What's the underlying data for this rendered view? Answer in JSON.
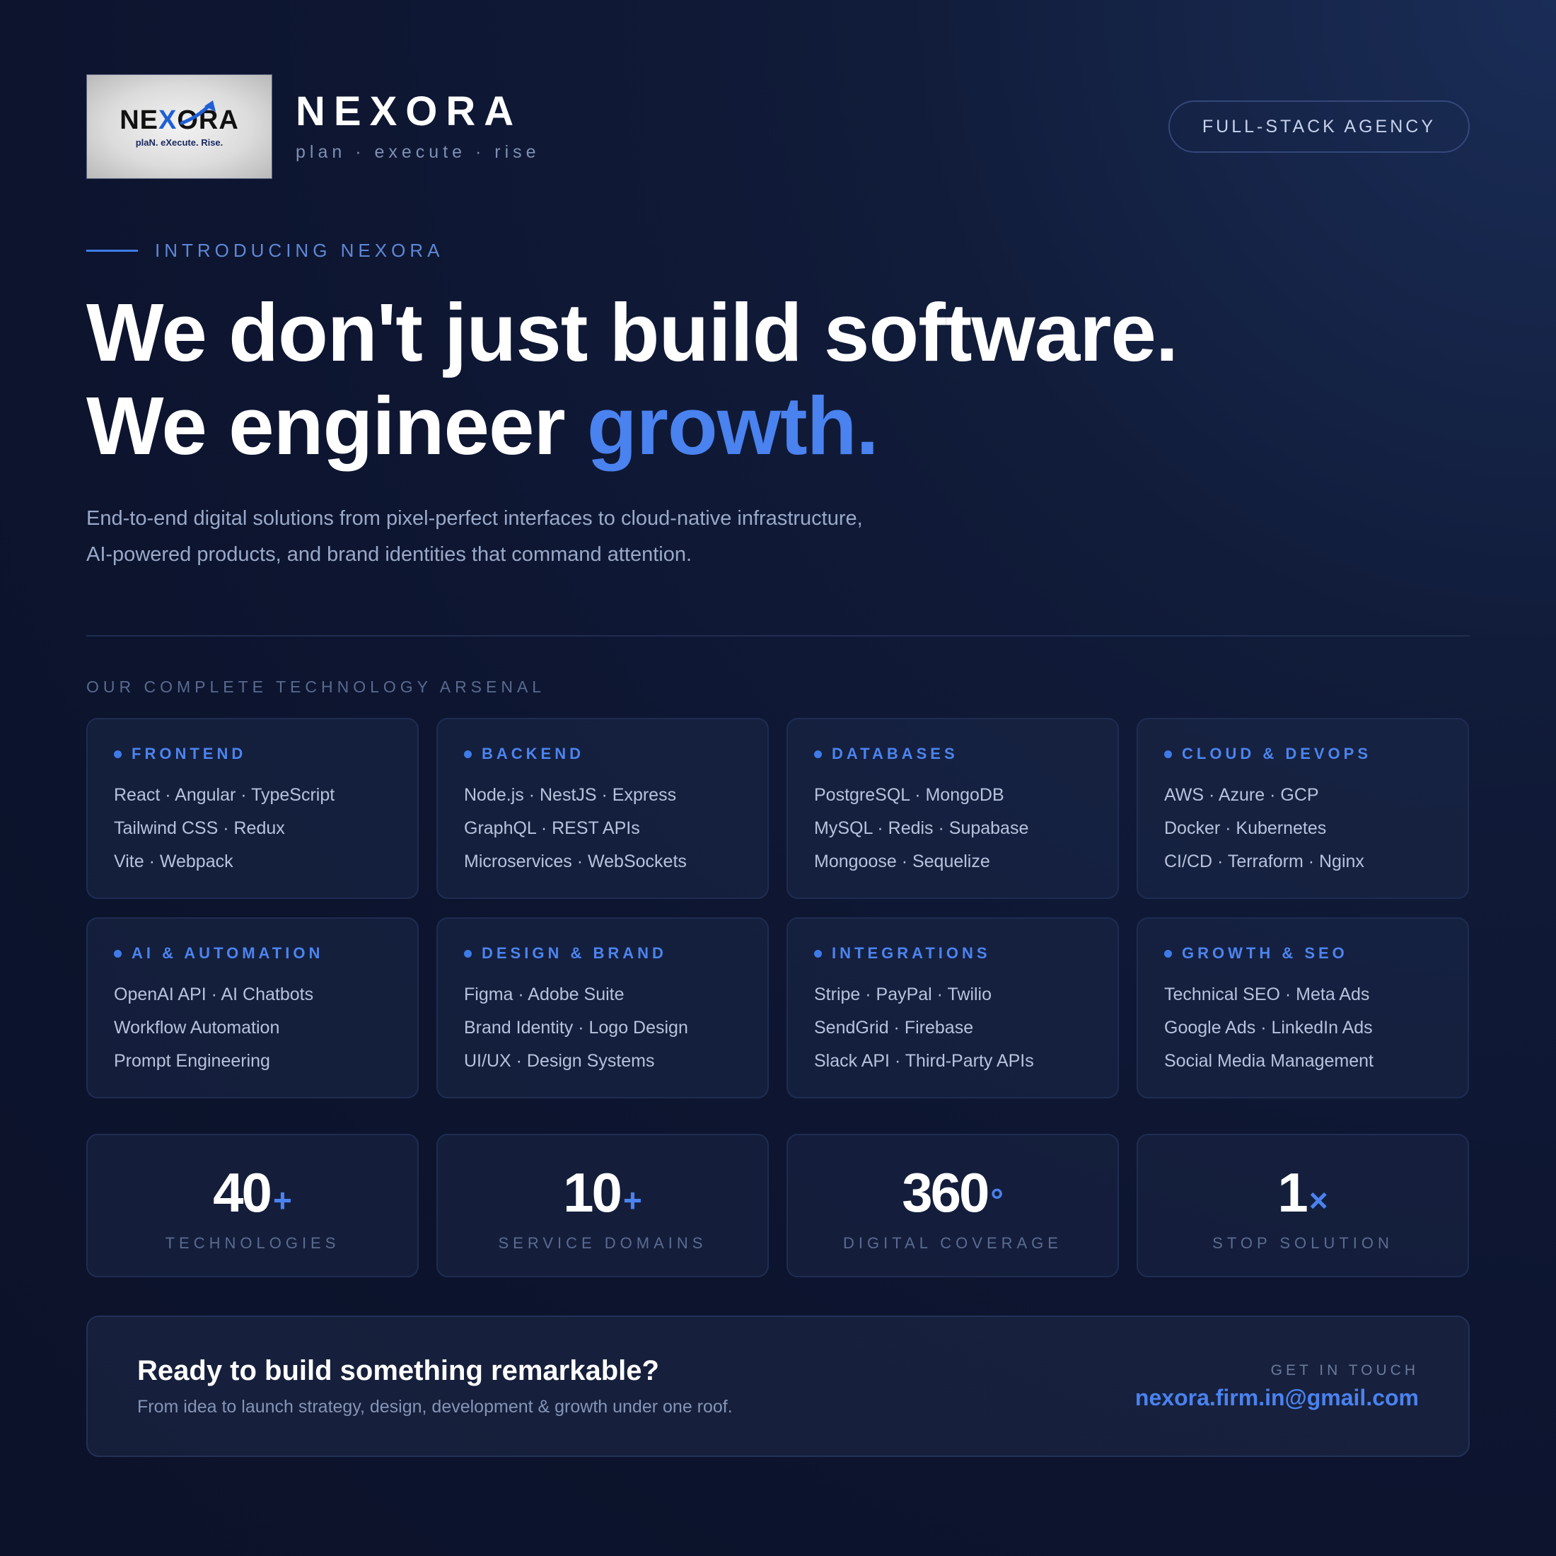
{
  "brand": {
    "logo_word_pre": "NE",
    "logo_word_x": "X",
    "logo_word_post": "ORA",
    "logo_tagline": "plaN. eXecute. Rise.",
    "name": "NEXORA",
    "tagline": "plan · execute · rise"
  },
  "header": {
    "badge": "FULL-STACK AGENCY"
  },
  "hero": {
    "eyebrow": "INTRODUCING NEXORA",
    "headline_line1": "We don't just build software.",
    "headline_line2_pre": "We engineer ",
    "headline_line2_accent": "growth.",
    "subtext_line1": "End-to-end digital solutions from pixel-perfect interfaces to cloud-native infrastructure,",
    "subtext_line2": "AI-powered products, and brand identities that command attention."
  },
  "arsenal": {
    "label": "OUR COMPLETE TECHNOLOGY ARSENAL",
    "cards": [
      {
        "title": "FRONTEND",
        "lines": [
          "React · Angular · TypeScript",
          "Tailwind CSS · Redux",
          "Vite · Webpack"
        ]
      },
      {
        "title": "BACKEND",
        "lines": [
          "Node.js · NestJS · Express",
          "GraphQL · REST APIs",
          "Microservices · WebSockets"
        ]
      },
      {
        "title": "DATABASES",
        "lines": [
          "PostgreSQL · MongoDB",
          "MySQL · Redis · Supabase",
          "Mongoose · Sequelize"
        ]
      },
      {
        "title": "CLOUD & DEVOPS",
        "lines": [
          "AWS · Azure · GCP",
          "Docker · Kubernetes",
          "CI/CD · Terraform · Nginx"
        ]
      },
      {
        "title": "AI & AUTOMATION",
        "lines": [
          "OpenAI API · AI Chatbots",
          "Workflow Automation",
          "Prompt Engineering"
        ]
      },
      {
        "title": "DESIGN & BRAND",
        "lines": [
          "Figma · Adobe Suite",
          "Brand Identity · Logo Design",
          "UI/UX · Design Systems"
        ]
      },
      {
        "title": "INTEGRATIONS",
        "lines": [
          "Stripe · PayPal · Twilio",
          "SendGrid · Firebase",
          "Slack API · Third-Party APIs"
        ]
      },
      {
        "title": "GROWTH & SEO",
        "lines": [
          "Technical SEO · Meta Ads",
          "Google Ads · LinkedIn Ads",
          "Social Media Management"
        ]
      }
    ]
  },
  "stats": [
    {
      "value": "40",
      "suffix": "+",
      "label": "TECHNOLOGIES"
    },
    {
      "value": "10",
      "suffix": "+",
      "label": "SERVICE DOMAINS"
    },
    {
      "value": "360",
      "suffix": "°",
      "label": "DIGITAL COVERAGE"
    },
    {
      "value": "1",
      "suffix": "×",
      "label": "STOP SOLUTION"
    }
  ],
  "cta": {
    "title": "Ready to build something remarkable?",
    "subtitle": "From idea to launch strategy, design, development & growth under one roof.",
    "contact_label": "GET IN TOUCH",
    "email": "nexora.firm.in@gmail.com"
  },
  "colors": {
    "accent": "#4a82ef",
    "background": "#0d1530",
    "card_border": "#1f2c52"
  },
  "icons": {
    "card_bullet": "dot-icon",
    "logo_arrow": "arrow-up-right-icon"
  }
}
